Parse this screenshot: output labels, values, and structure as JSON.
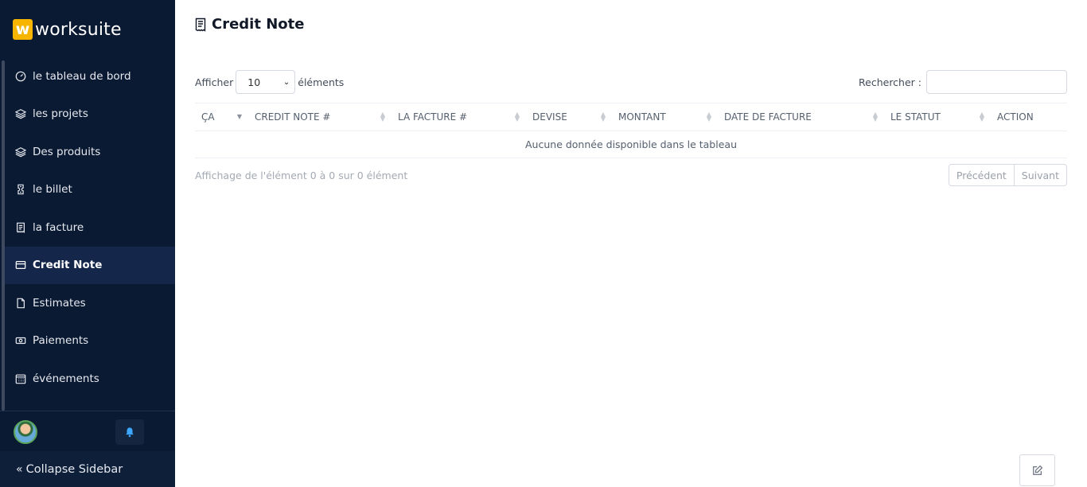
{
  "brand": {
    "logo_letter": "w",
    "name": "worksuite"
  },
  "sidebar": {
    "items": [
      {
        "label": "le tableau de bord",
        "icon": "speedometer-icon"
      },
      {
        "label": "les projets",
        "icon": "layers-icon"
      },
      {
        "label": "Des produits",
        "icon": "layers-icon"
      },
      {
        "label": "le billet",
        "icon": "ticket-icon"
      },
      {
        "label": "la facture",
        "icon": "receipt-icon"
      },
      {
        "label": "Credit Note",
        "icon": "credit-card-icon",
        "active": true
      },
      {
        "label": "Estimates",
        "icon": "file-icon"
      },
      {
        "label": "Paiements",
        "icon": "money-icon"
      },
      {
        "label": "événements",
        "icon": "calendar-icon"
      }
    ],
    "collapse_label": "Collapse Sidebar"
  },
  "page": {
    "title": "Credit Note"
  },
  "controls": {
    "show_label": "Afficher",
    "page_size": "10",
    "elements_label": "éléments",
    "search_label": "Rechercher :"
  },
  "table": {
    "columns": [
      "ÇA",
      "CREDIT NOTE #",
      "LA FACTURE #",
      "DEVISE",
      "MONTANT",
      "DATE DE FACTURE",
      "LE STATUT",
      "ACTION"
    ],
    "empty_text": "Aucune donnée disponible dans le tableau"
  },
  "footer": {
    "info": "Affichage de l'élément 0 à 0 sur 0 élément",
    "prev": "Précédent",
    "next": "Suivant"
  },
  "colors": {
    "sidebar_bg": "#0b1a33",
    "brand_accent": "#f7b500",
    "bell": "#3da6ff"
  }
}
